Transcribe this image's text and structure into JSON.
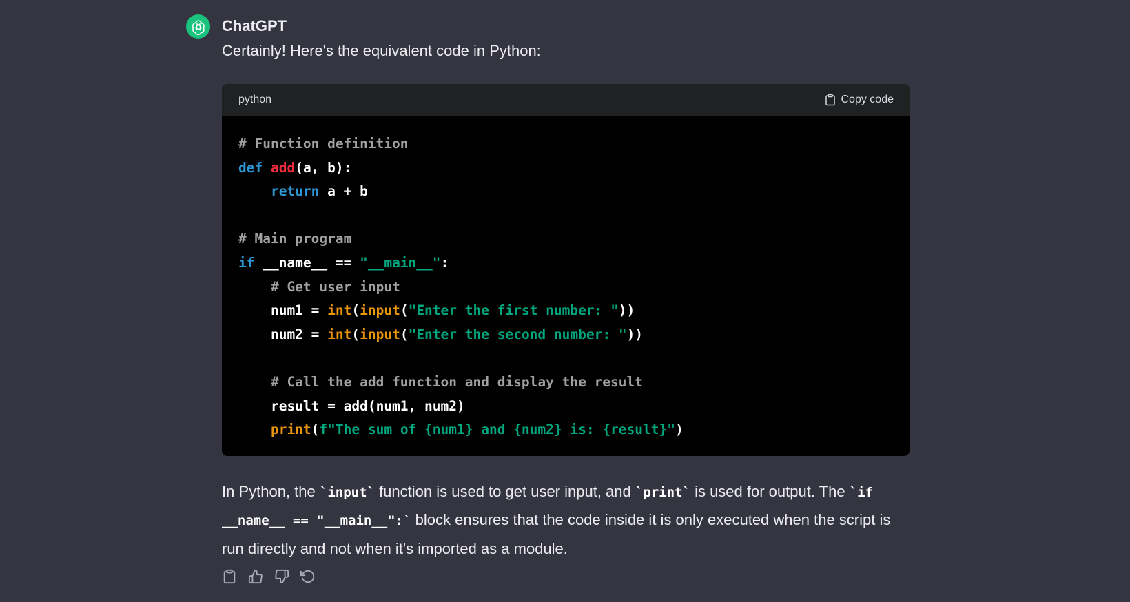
{
  "message": {
    "sender": "ChatGPT",
    "avatar_icon": "openai-logo-icon",
    "avatar_color": "#19c37d",
    "intro": "Certainly! Here's the equivalent code in Python:"
  },
  "code_block": {
    "language": "python",
    "copy_label": "Copy code",
    "copy_icon": "clipboard-icon",
    "lines": [
      [
        {
          "t": "# Function definition",
          "k": "comment"
        }
      ],
      [
        {
          "t": "def ",
          "k": "keyword"
        },
        {
          "t": "add",
          "k": "func"
        },
        {
          "t": "(a, b):",
          "k": "plain"
        }
      ],
      [
        {
          "t": "    ",
          "k": "plain"
        },
        {
          "t": "return",
          "k": "keyword"
        },
        {
          "t": " a + b",
          "k": "plain"
        }
      ],
      [],
      [
        {
          "t": "# Main program",
          "k": "comment"
        }
      ],
      [
        {
          "t": "if",
          "k": "keyword"
        },
        {
          "t": " __name__ == ",
          "k": "plain"
        },
        {
          "t": "\"__main__\"",
          "k": "string"
        },
        {
          "t": ":",
          "k": "plain"
        }
      ],
      [
        {
          "t": "    ",
          "k": "plain"
        },
        {
          "t": "# Get user input",
          "k": "comment"
        }
      ],
      [
        {
          "t": "    num1 = ",
          "k": "plain"
        },
        {
          "t": "int",
          "k": "builtin"
        },
        {
          "t": "(",
          "k": "plain"
        },
        {
          "t": "input",
          "k": "builtin"
        },
        {
          "t": "(",
          "k": "plain"
        },
        {
          "t": "\"Enter the first number: \"",
          "k": "string"
        },
        {
          "t": "))",
          "k": "plain"
        }
      ],
      [
        {
          "t": "    num2 = ",
          "k": "plain"
        },
        {
          "t": "int",
          "k": "builtin"
        },
        {
          "t": "(",
          "k": "plain"
        },
        {
          "t": "input",
          "k": "builtin"
        },
        {
          "t": "(",
          "k": "plain"
        },
        {
          "t": "\"Enter the second number: \"",
          "k": "string"
        },
        {
          "t": "))",
          "k": "plain"
        }
      ],
      [],
      [
        {
          "t": "    ",
          "k": "plain"
        },
        {
          "t": "# Call the add function and display the result",
          "k": "comment"
        }
      ],
      [
        {
          "t": "    result = add(num1, num2)",
          "k": "plain"
        }
      ],
      [
        {
          "t": "    ",
          "k": "plain"
        },
        {
          "t": "print",
          "k": "builtin"
        },
        {
          "t": "(",
          "k": "plain"
        },
        {
          "t": "f\"The sum of {num1} and {num2} is: {result}\"",
          "k": "string"
        },
        {
          "t": ")",
          "k": "plain"
        }
      ]
    ]
  },
  "explanation": {
    "segments": [
      {
        "t": "In Python, the ",
        "code": false
      },
      {
        "t": "`input`",
        "code": true
      },
      {
        "t": " function is used to get user input, and ",
        "code": false
      },
      {
        "t": "`print`",
        "code": true
      },
      {
        "t": " is used for output. The ",
        "code": false
      },
      {
        "t": "`if __name__ == \"__main__\":`",
        "code": true
      },
      {
        "t": " block ensures that the code inside it is only executed when the script is run directly and not when it's imported as a module.",
        "code": false
      }
    ]
  },
  "actions": [
    {
      "name": "copy-response-button",
      "icon": "clipboard-icon"
    },
    {
      "name": "thumbs-up-button",
      "icon": "thumbs-up-icon"
    },
    {
      "name": "thumbs-down-button",
      "icon": "thumbs-down-icon"
    },
    {
      "name": "regenerate-button",
      "icon": "refresh-icon"
    }
  ],
  "colors": {
    "background": "#343541",
    "code_header": "#202123",
    "code_body": "#000000",
    "comment": "#a0a0a0",
    "keyword": "#2e95d3",
    "function": "#f22c3d",
    "string": "#00a67d",
    "builtin": "#e9950c"
  }
}
